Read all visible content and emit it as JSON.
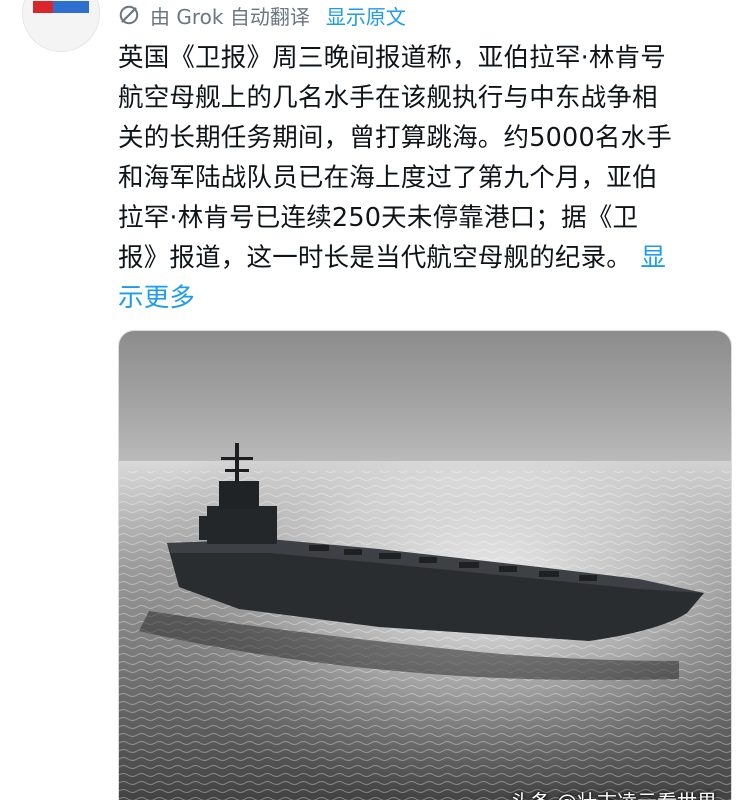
{
  "translation": {
    "label": "由 Grok 自动翻译",
    "show_original": "显示原文"
  },
  "post": {
    "lines": [
      "英国《卫报》周三晚间报道称，亚伯拉罕·林肯号",
      "航空母舰上的几名水手在该舰执行与中东战争相",
      "关的长期任务期间，曾打算跳海。约5000名水手",
      "和海军陆战队员已在海上度过了第九个月，亚伯",
      "拉罕·林肯号已连续250天未停靠港口；据《卫"
    ],
    "last_line": "报》报道，这一时长是当代航空母舰的纪录。",
    "show_more_part1": "显",
    "show_more_part2": "示更多"
  },
  "media": {
    "watermark": "头条 @壮志凌云看世界"
  },
  "colors": {
    "link": "#1d9bf0",
    "text": "#0f1419",
    "muted": "#6b7680"
  },
  "icons": {
    "translate": "grok-icon"
  }
}
